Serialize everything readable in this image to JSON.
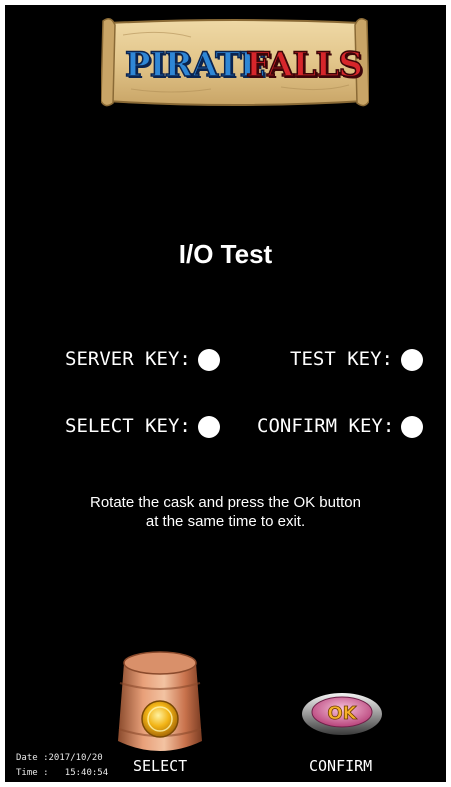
{
  "logo": {
    "word1": "PIRATE",
    "word2": "FALLS"
  },
  "title": "I/O Test",
  "keys": [
    {
      "label": "SERVER KEY:"
    },
    {
      "label": "TEST KEY:"
    },
    {
      "label": "SELECT KEY:"
    },
    {
      "label": "CONFIRM KEY:"
    }
  ],
  "instructions": {
    "line1": "Rotate the cask and press the OK button",
    "line2": "at the same time to exit."
  },
  "buttons": {
    "select_label": "SELECT",
    "confirm_label": "CONFIRM",
    "ok_text": "OK"
  },
  "stamp": {
    "date_label": "Date :",
    "date_value": "2017/10/20",
    "time_label": "Time :",
    "time_value": "15:40:54"
  },
  "colors": {
    "background": "#000000",
    "text": "#ffffff",
    "indicator": "#ffffff"
  }
}
